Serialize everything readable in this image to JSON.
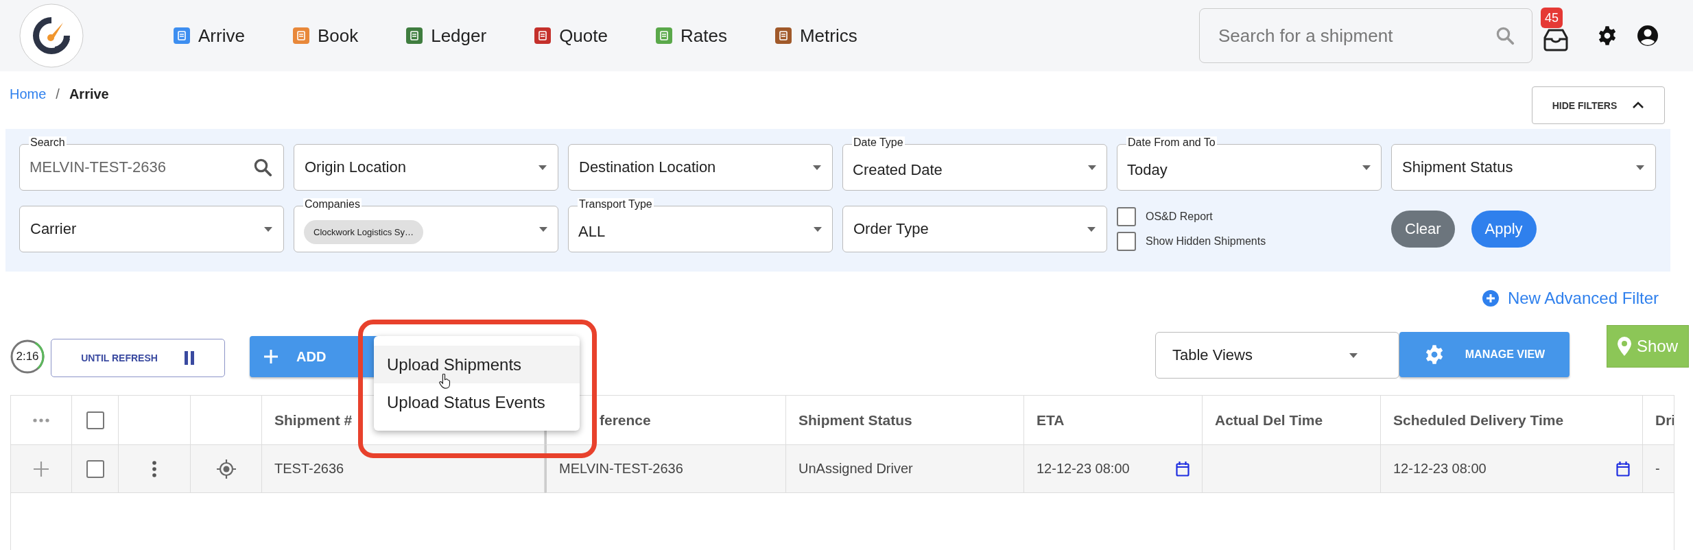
{
  "nav": [
    {
      "label": "Arrive",
      "color": "#3d8ef0"
    },
    {
      "label": "Book",
      "color": "#e8883a"
    },
    {
      "label": "Ledger",
      "color": "#3f7d3f"
    },
    {
      "label": "Quote",
      "color": "#c4302b"
    },
    {
      "label": "Rates",
      "color": "#5aa84a"
    },
    {
      "label": "Metrics",
      "color": "#a0592a"
    }
  ],
  "search": {
    "placeholder": "Search for a shipment"
  },
  "notifications": {
    "count": "45"
  },
  "breadcrumb": [
    {
      "label": "Home",
      "kind": "link"
    },
    {
      "label": "/",
      "kind": "separator"
    },
    {
      "label": "Arrive",
      "kind": "current"
    }
  ],
  "hide_filters": {
    "label": "HIDE FILTERS"
  },
  "filters": [
    {
      "kind": "search",
      "label": "Search",
      "value": "MELVIN-TEST-2636"
    },
    {
      "kind": "select",
      "text": "Origin Location"
    },
    {
      "kind": "select",
      "text": "Destination Location"
    },
    {
      "kind": "select",
      "label": "Date Type",
      "value": "Created Date"
    },
    {
      "kind": "select",
      "label": "Date From and To",
      "value": "Today"
    },
    {
      "kind": "select",
      "text": "Shipment Status"
    },
    {
      "kind": "select",
      "text": "Carrier"
    },
    {
      "kind": "chips",
      "label": "Companies",
      "chips": [
        "Clockwork Logistics Sy…"
      ]
    },
    {
      "kind": "select",
      "label": "Transport Type",
      "value": "ALL"
    },
    {
      "kind": "select",
      "text": "Order Type"
    },
    {
      "kind": "checks",
      "items": [
        {
          "label": "OS&D Report",
          "checked": false
        },
        {
          "label": "Show Hidden Shipments",
          "checked": false
        }
      ]
    },
    {
      "kind": "actions",
      "buttons": [
        {
          "label": "Clear",
          "kind": "secondary"
        },
        {
          "label": "Apply",
          "kind": "primary"
        }
      ]
    }
  ],
  "advanced_filter": {
    "label": "New Advanced Filter"
  },
  "timer": {
    "text": "2:16",
    "level": 0.3
  },
  "refresh_button": {
    "label": "UNTIL REFRESH"
  },
  "add_button": {
    "label": "ADD"
  },
  "add_menu": [
    {
      "label": "Upload Shipments",
      "hovered": true
    },
    {
      "label": "Upload Status Events",
      "hovered": false
    }
  ],
  "table_views": {
    "text": "Table Views"
  },
  "manage_view": {
    "label": "MANAGE VIEW"
  },
  "show_button": {
    "label": "Show"
  },
  "table": {
    "columns": [
      {
        "kind": "more"
      },
      {
        "kind": "checkbox",
        "checked": false
      },
      {
        "kind": "blank"
      },
      {
        "kind": "blank"
      },
      {
        "kind": "text",
        "label": "Shipment #"
      },
      {
        "kind": "covered",
        "label": "ference"
      },
      {
        "kind": "text",
        "label": "Shipment Status"
      },
      {
        "kind": "text",
        "label": "ETA"
      },
      {
        "kind": "text",
        "label": "Actual Del Time"
      },
      {
        "kind": "text",
        "label": "Scheduled Delivery Time"
      },
      {
        "kind": "text",
        "label": "Dri"
      }
    ],
    "rows": [
      {
        "cells": [
          {
            "kind": "expand"
          },
          {
            "kind": "checkbox",
            "checked": false
          },
          {
            "kind": "kebab"
          },
          {
            "kind": "locate"
          },
          {
            "kind": "text",
            "text": "TEST-2636"
          },
          {
            "kind": "text",
            "text": "MELVIN-TEST-2636"
          },
          {
            "kind": "text",
            "text": "UnAssigned Driver"
          },
          {
            "kind": "date",
            "text": "12-12-23 08:00"
          },
          {
            "kind": "empty"
          },
          {
            "kind": "date",
            "text": "12-12-23 08:00"
          },
          {
            "kind": "text",
            "text": "-"
          }
        ]
      }
    ]
  }
}
